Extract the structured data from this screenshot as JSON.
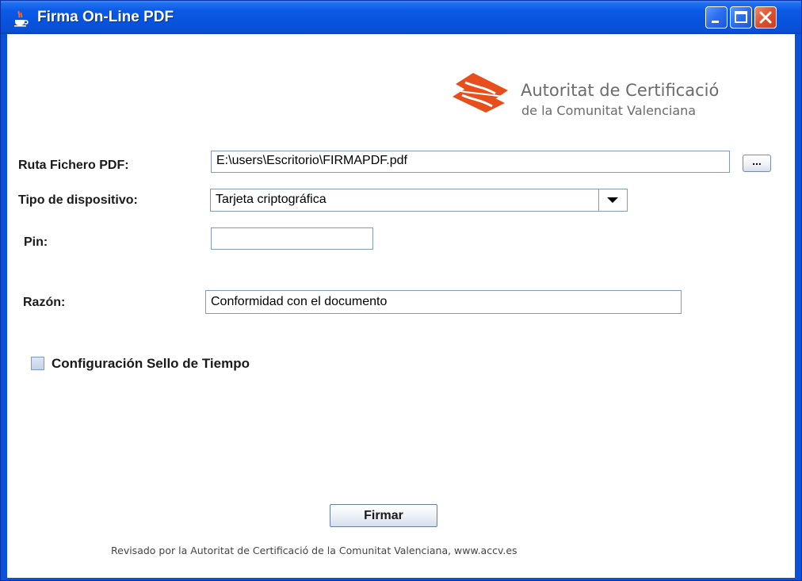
{
  "window": {
    "title": "Firma On-Line PDF",
    "icon": "java-cup-icon",
    "controls": [
      "minimize-icon",
      "maximize-icon",
      "close-icon"
    ]
  },
  "logo": {
    "line1": "Autoritat de Certificació",
    "line2": "de la Comunitat Valenciana",
    "color": "#e84e1b"
  },
  "form": {
    "ruta": {
      "label": "Ruta Fichero PDF:",
      "value": "E:\\users\\Escritorio\\FIRMAPDF.pdf",
      "browse_label": "..."
    },
    "tipo": {
      "label": "Tipo de dispositivo:",
      "value": "Tarjeta criptográfica"
    },
    "pin": {
      "label": "Pin:",
      "value": ""
    },
    "razon": {
      "label": "Razón:",
      "value": "Conformidad con el documento"
    },
    "sello": {
      "label": "Configuración Sello de Tiempo",
      "checked": false
    }
  },
  "actions": {
    "firmar_label": "Firmar"
  },
  "footer": {
    "text": "Revisado por la Autoritat de Certificació de la Comunitat Valenciana, www.accv.es"
  },
  "colors": {
    "titlebar": "#0a52d8",
    "field_border": "#7f9db9",
    "logo": "#e84e1b"
  }
}
